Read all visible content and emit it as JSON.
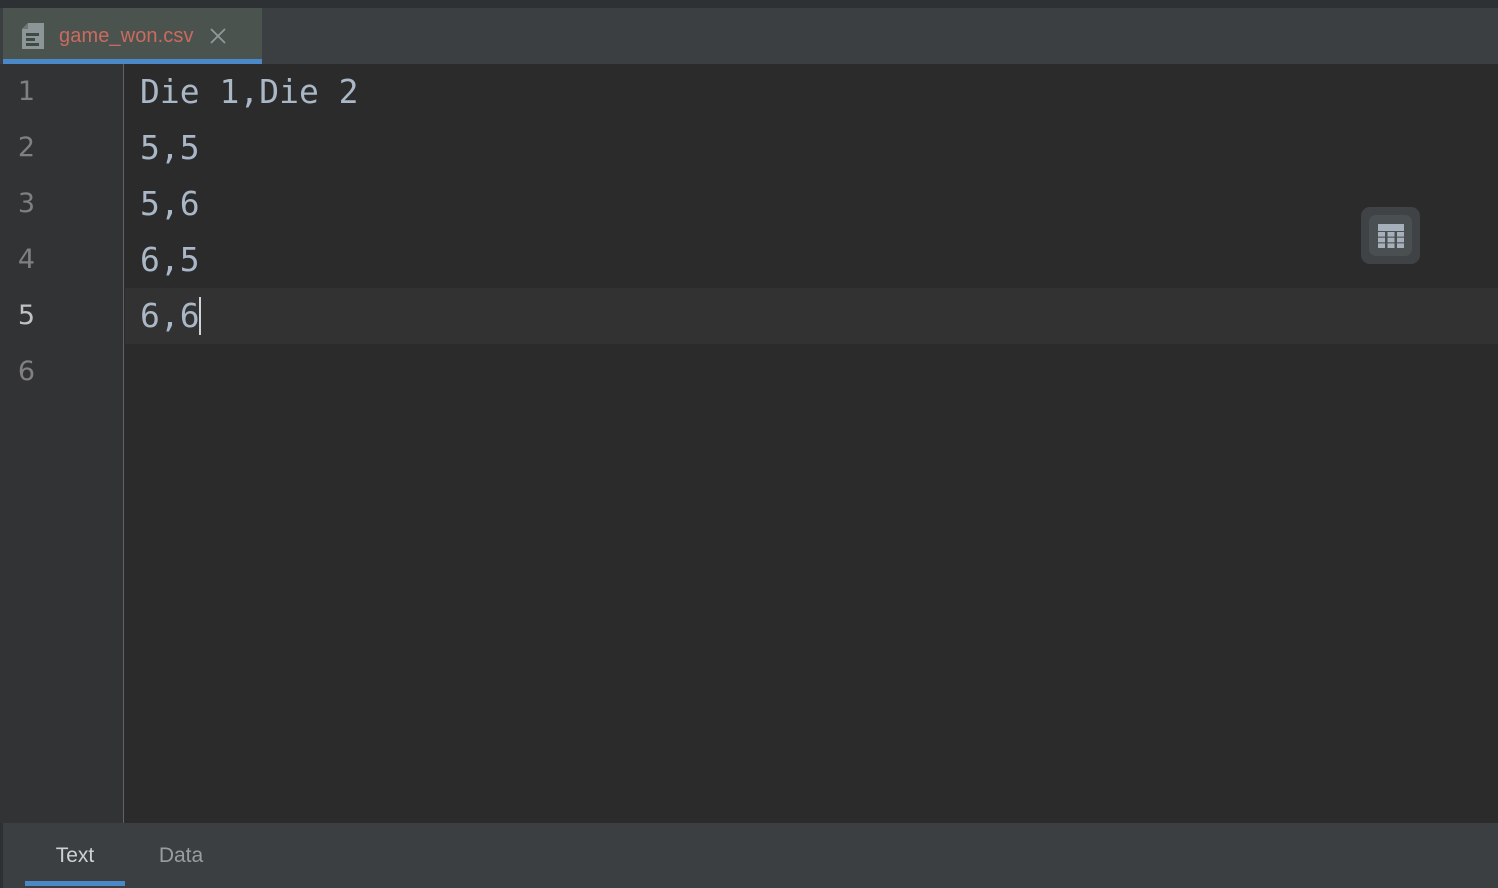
{
  "window": {
    "theme": "darcula",
    "colors": {
      "editor_bg": "#2b2b2b",
      "gutter_bg": "#313335",
      "chrome_bg": "#3c3f41",
      "active_tab_bg": "#4b534e",
      "accent_blue": "#4a88c7",
      "filename_red": "#cb6a60",
      "code_text": "#a9b7c6",
      "line_number": "#808080",
      "line_number_active": "#c2c2c2",
      "current_line_bg": "#323232"
    }
  },
  "editor_tabs": [
    {
      "label": "game_won.csv",
      "icon": "csv-file-icon",
      "close_icon": "close-icon",
      "active": true
    }
  ],
  "editor": {
    "language": "csv",
    "gutter_numbers": [
      "1",
      "2",
      "3",
      "4",
      "5",
      "6"
    ],
    "active_line": 5,
    "caret_line": 5,
    "caret_column": 4,
    "lines": [
      {
        "number": "1",
        "text": "Die 1,Die 2",
        "active": false
      },
      {
        "number": "2",
        "text": "5,5",
        "active": false
      },
      {
        "number": "3",
        "text": "5,6",
        "active": false
      },
      {
        "number": "4",
        "text": "6,5",
        "active": false
      },
      {
        "number": "5",
        "text": "6,6",
        "active": true
      },
      {
        "number": "6",
        "text": "",
        "active": false
      }
    ]
  },
  "floating_actions": [
    {
      "name": "open-as-table",
      "icon": "table-icon"
    }
  ],
  "bottom_tabs": [
    {
      "label": "Text",
      "active": true
    },
    {
      "label": "Data",
      "active": false
    }
  ]
}
